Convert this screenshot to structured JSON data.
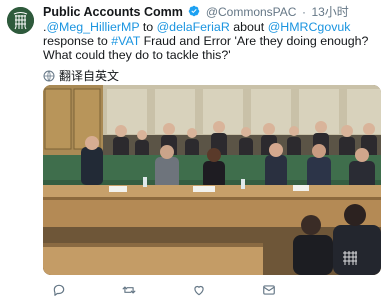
{
  "tweet": {
    "display_name": "Public Accounts Comm",
    "handle": "@CommonsPAC",
    "time": "13小时",
    "body_parts": [
      {
        "text": ".",
        "link": false
      },
      {
        "text": "@Meg_HillierMP",
        "link": true
      },
      {
        "text": " to ",
        "link": false
      },
      {
        "text": "@delaFeriaR",
        "link": true
      },
      {
        "text": " about ",
        "link": false
      },
      {
        "text": "@HMRCgovuk",
        "link": true
      },
      {
        "text": " response to ",
        "link": false
      },
      {
        "text": "#VAT",
        "link": true
      },
      {
        "text": " Fraud and Error 'Are they doing enough? What could they do to tackle this?'",
        "link": false
      }
    ],
    "translate_label": "翻译自英文"
  },
  "colors": {
    "link": "#1b95e0",
    "verified": "#1da1f2",
    "muted": "#657786",
    "bench_green": "#3f6e4c"
  },
  "icons": {
    "verified": "verified-badge-icon",
    "translate": "globe-icon",
    "reply": "reply-icon",
    "retweet": "retweet-icon",
    "like": "heart-icon",
    "share": "share-envelope-icon"
  }
}
